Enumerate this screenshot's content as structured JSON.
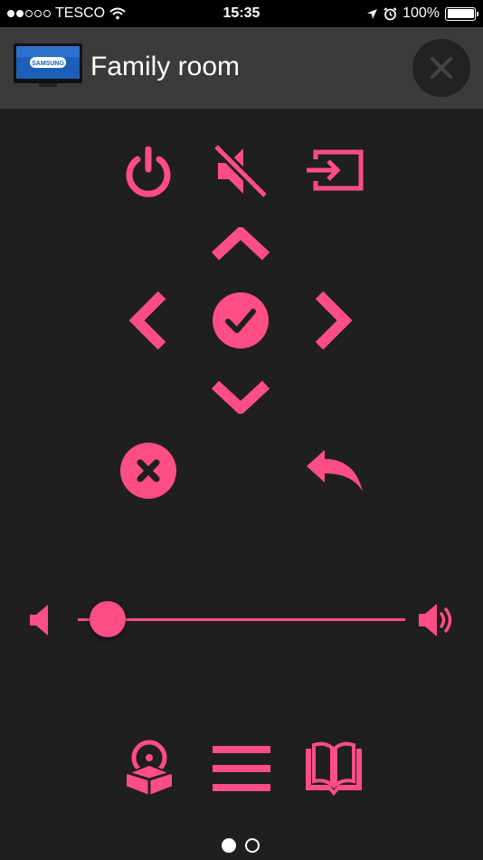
{
  "status_bar": {
    "carrier": "TESCO",
    "time": "15:35",
    "battery": "100%",
    "signal_dots_filled": 2,
    "signal_dots_total": 5
  },
  "header": {
    "title": "Family room",
    "device_brand": "SAMSUNG"
  },
  "controls": {
    "power": "power-icon",
    "mute": "mute-icon",
    "input": "input-source-icon",
    "up": "chevron-up-icon",
    "left": "chevron-left-icon",
    "ok": "ok-check-icon",
    "right": "chevron-right-icon",
    "down": "chevron-down-icon",
    "exit": "exit-icon",
    "back": "back-icon",
    "media": "media-icon",
    "menu": "menu-icon",
    "guide": "guide-icon"
  },
  "volume": {
    "level": 0.09
  },
  "pager": {
    "current_page": 1,
    "page_count": 2
  },
  "colors": {
    "accent": "#ff4d85",
    "background": "#1f1f1f",
    "header": "#3b3b3b",
    "status_bar": "#000000"
  }
}
